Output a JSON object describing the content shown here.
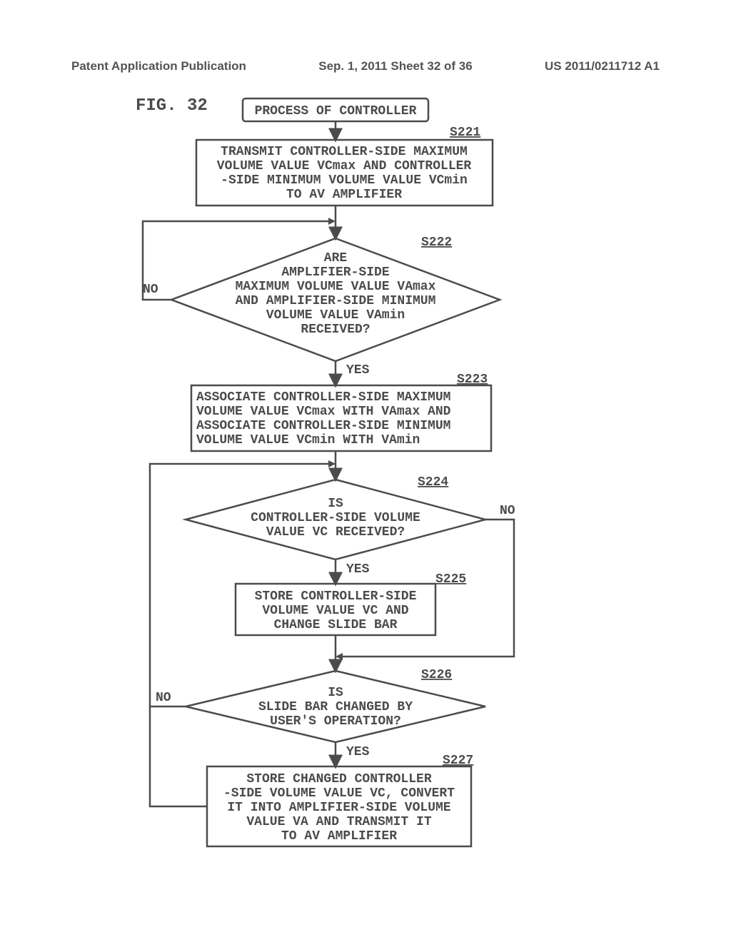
{
  "chart_data": {
    "type": "flowchart",
    "title": "FIG. 32",
    "nodes": [
      {
        "id": "start",
        "kind": "terminator",
        "text": "PROCESS OF CONTROLLER"
      },
      {
        "id": "s221",
        "kind": "process",
        "step": "S221",
        "text": "TRANSMIT CONTROLLER-SIDE MAXIMUM VOLUME VALUE VCmax AND CONTROLLER-SIDE MINIMUM VOLUME VALUE VCmin TO AV AMPLIFIER"
      },
      {
        "id": "s222",
        "kind": "decision",
        "step": "S222",
        "text": "ARE AMPLIFIER-SIDE MAXIMUM VOLUME VALUE VAmax AND AMPLIFIER-SIDE MINIMUM VOLUME VALUE VAmin RECEIVED?"
      },
      {
        "id": "s223",
        "kind": "process",
        "step": "S223",
        "text": "ASSOCIATE CONTROLLER-SIDE MAXIMUM VOLUME VALUE VCmax WITH VAmax AND ASSOCIATE CONTROLLER-SIDE MINIMUM VOLUME VALUE VCmin WITH VAmin"
      },
      {
        "id": "s224",
        "kind": "decision",
        "step": "S224",
        "text": "IS CONTROLLER-SIDE VOLUME VALUE VC RECEIVED?"
      },
      {
        "id": "s225",
        "kind": "process",
        "step": "S225",
        "text": "STORE CONTROLLER-SIDE VOLUME VALUE VC AND CHANGE SLIDE BAR"
      },
      {
        "id": "s226",
        "kind": "decision",
        "step": "S226",
        "text": "IS SLIDE BAR CHANGED BY USER'S OPERATION?"
      },
      {
        "id": "s227",
        "kind": "process",
        "step": "S227",
        "text": "STORE CHANGED CONTROLLER-SIDE VOLUME VALUE VC, CONVERT IT INTO AMPLIFIER-SIDE VOLUME VALUE VA AND TRANSMIT IT TO AV AMPLIFIER"
      }
    ],
    "edges": [
      {
        "from": "start",
        "to": "s221"
      },
      {
        "from": "s221",
        "to": "s222"
      },
      {
        "from": "s222",
        "to": "s223",
        "label": "YES"
      },
      {
        "from": "s222",
        "to": "s222",
        "label": "NO",
        "note": "loop back above s222"
      },
      {
        "from": "s223",
        "to": "s224"
      },
      {
        "from": "s224",
        "to": "s225",
        "label": "YES"
      },
      {
        "from": "s224",
        "to": "s226",
        "label": "NO",
        "note": "bypass to merge above s226"
      },
      {
        "from": "s225",
        "to": "s226"
      },
      {
        "from": "s226",
        "to": "s227",
        "label": "YES"
      },
      {
        "from": "s226",
        "to": "s224",
        "label": "NO",
        "note": "loop back above s224"
      },
      {
        "from": "s227",
        "to": "s224",
        "note": "loop back above s224"
      }
    ]
  },
  "header": {
    "left": "Patent Application Publication",
    "center": "Sep. 1, 2011  Sheet 32 of 36",
    "right": "US 2011/0211712 A1"
  },
  "figure_label": "FIG.  32",
  "start": {
    "title": "PROCESS OF CONTROLLER"
  },
  "s221": {
    "num": "S221",
    "l1": "TRANSMIT CONTROLLER-SIDE MAXIMUM",
    "l2": "VOLUME VALUE VCmax AND CONTROLLER",
    "l3": "-SIDE MINIMUM VOLUME VALUE VCmin",
    "l4": "TO AV AMPLIFIER"
  },
  "s222": {
    "num": "S222",
    "no": "NO",
    "yes": "YES",
    "l1": "ARE",
    "l2": "AMPLIFIER-SIDE",
    "l3": "MAXIMUM VOLUME VALUE VAmax",
    "l4": "AND AMPLIFIER-SIDE MINIMUM",
    "l5": "VOLUME VALUE VAmin",
    "l6": "RECEIVED?"
  },
  "s223": {
    "num": "S223",
    "l1": "ASSOCIATE CONTROLLER-SIDE MAXIMUM",
    "l2": "VOLUME VALUE VCmax WITH VAmax AND",
    "l3": "ASSOCIATE CONTROLLER-SIDE MINIMUM",
    "l4": "VOLUME VALUE VCmin WITH VAmin"
  },
  "s224": {
    "num": "S224",
    "no": "NO",
    "yes": "YES",
    "l1": "IS",
    "l2": "CONTROLLER-SIDE VOLUME",
    "l3": "VALUE VC RECEIVED?"
  },
  "s225": {
    "num": "S225",
    "l1": "STORE CONTROLLER-SIDE",
    "l2": "VOLUME VALUE VC AND",
    "l3": "CHANGE SLIDE BAR"
  },
  "s226": {
    "num": "S226",
    "no": "NO",
    "yes": "YES",
    "l1": "IS",
    "l2": "SLIDE BAR CHANGED BY",
    "l3": "USER'S OPERATION?"
  },
  "s227": {
    "num": "S227",
    "l1": "STORE CHANGED CONTROLLER",
    "l2": "-SIDE VOLUME VALUE VC, CONVERT",
    "l3": "IT INTO AMPLIFIER-SIDE VOLUME",
    "l4": "VALUE VA AND TRANSMIT IT",
    "l5": "TO AV AMPLIFIER"
  }
}
